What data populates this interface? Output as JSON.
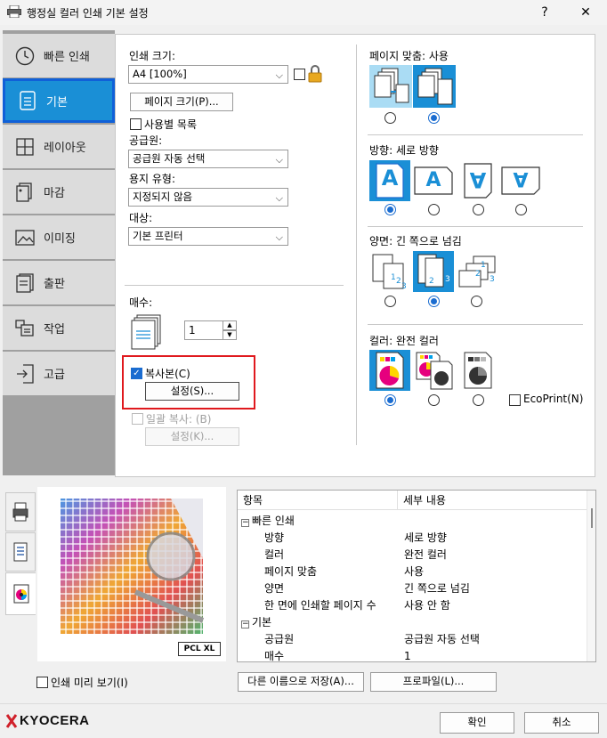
{
  "window": {
    "title": "행정실 컬러 인쇄 기본 설정",
    "help": "?",
    "close": "✕"
  },
  "nav": [
    {
      "label": "빠른 인쇄",
      "icon": "clock-icon"
    },
    {
      "label": "기본",
      "icon": "document-icon"
    },
    {
      "label": "레이아웃",
      "icon": "layout-grid-icon"
    },
    {
      "label": "마감",
      "icon": "finishing-icon"
    },
    {
      "label": "이미징",
      "icon": "image-icon"
    },
    {
      "label": "출판",
      "icon": "publishing-icon"
    },
    {
      "label": "작업",
      "icon": "job-icon"
    },
    {
      "label": "고급",
      "icon": "advanced-icon"
    }
  ],
  "basic": {
    "print_size_label": "인쇄 크기:",
    "print_size_value": "A4 [100%]",
    "page_size_button": "페이지 크기(P)...",
    "custom_list_label": "사용별 목록",
    "source_label": "공급원:",
    "source_value": "공급원 자동 선택",
    "media_label": "용지 유형:",
    "media_value": "지정되지 않음",
    "dest_label": "대상:",
    "dest_value": "기본 프린터",
    "copies_label": "매수:",
    "copies_value": "1",
    "copy_check_label": "복사본(C)",
    "copy_settings_button": "설정(S)...",
    "batch_copy_label": "일괄 복사: (B)",
    "batch_settings_button": "설정(K)..."
  },
  "right": {
    "fit_label": "페이지 맞춤: 사용",
    "orientation_label": "방향: 세로 방향",
    "duplex_label": "양면: 긴 쪽으로 넘김",
    "color_label": "컬러: 완전 컬러",
    "ecoprint_label": "EcoPrint(N)",
    "orientation_glyph": "A"
  },
  "bottom": {
    "preview_badge": "PCL XL",
    "preview_check": "인쇄 미리 보기(I)",
    "save_as_button": "다른 이름으로 저장(A)...",
    "profile_button": "프로파일(L)...",
    "ok_button": "확인",
    "cancel_button": "취소",
    "logo_text": "KYOCERA"
  },
  "table": {
    "headers": [
      "항목",
      "세부 내용"
    ],
    "groups": [
      {
        "name": "빠른 인쇄",
        "toggle": "−"
      },
      {
        "name": "기본",
        "toggle": "−"
      }
    ],
    "rows": [
      {
        "item": "방향",
        "detail": "세로 방향"
      },
      {
        "item": "컬러",
        "detail": "완전 컬러"
      },
      {
        "item": "페이지 맞춤",
        "detail": "사용"
      },
      {
        "item": "양면",
        "detail": "긴 쪽으로 넘김"
      },
      {
        "item": "한 면에 인쇄할 페이지 수",
        "detail": "사용 안 함"
      },
      {
        "item": "공급원",
        "detail": "공급원 자동 선택"
      },
      {
        "item": "매수",
        "detail": "1"
      }
    ]
  }
}
